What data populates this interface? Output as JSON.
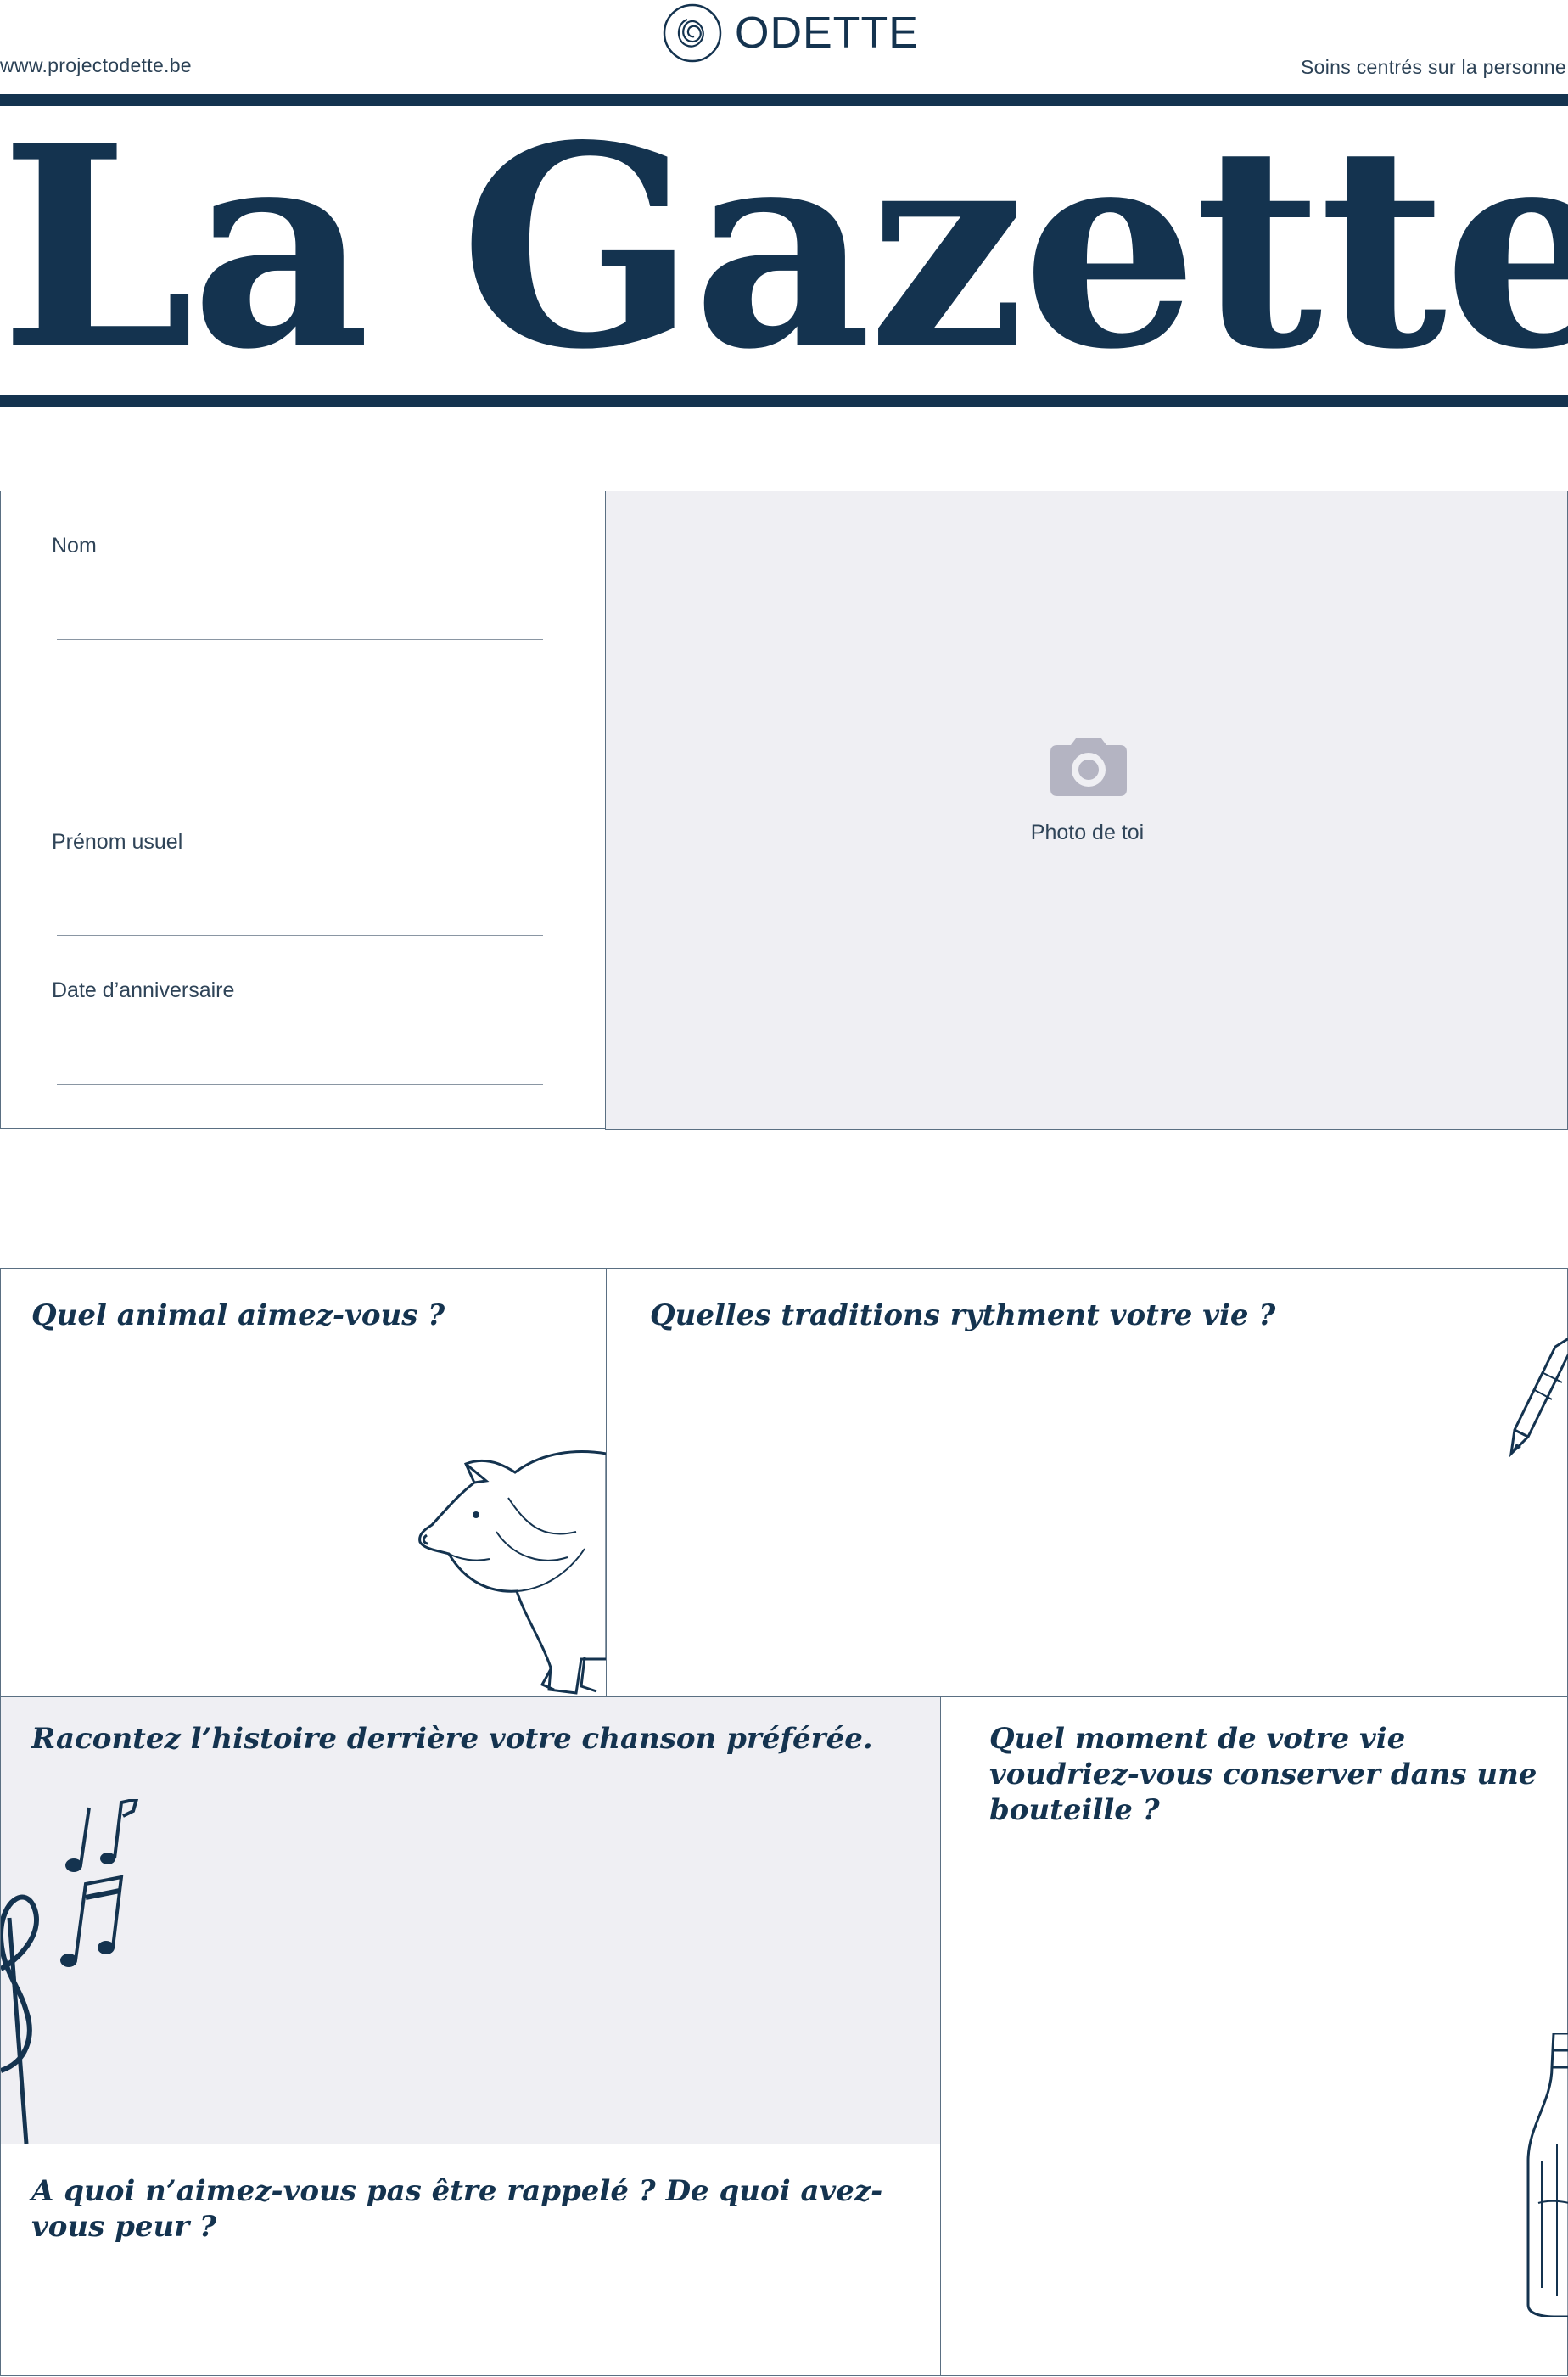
{
  "header": {
    "website": "www.projectodette.be",
    "brand": "ODETTE",
    "tagline": "Soins centrés sur la personne",
    "title": "La Gazette"
  },
  "identity": {
    "name_label": "Nom",
    "first_name_label": "Prénom usuel",
    "birthday_label": "Date d’anniversaire",
    "photo_label": "Photo de toi"
  },
  "questions": {
    "animal": "Quel animal aimez-vous ?",
    "traditions": "Quelles traditions rythment votre vie ?",
    "song": "Racontez l’histoire derrière votre chanson préférée.",
    "bottle": "Quel moment de votre vie voudriez-vous conserver dans une bouteille ?",
    "fear": "A quoi n’aimez-vous pas être rappelé ? De quoi avez-vous peur ?"
  },
  "icons": [
    "odette-logo-icon",
    "camera-icon",
    "pig-illustration",
    "pencil-illustration",
    "music-notes-illustration",
    "bottle-illustration"
  ],
  "colors": {
    "navy": "#14334f",
    "panel": "#efeff3",
    "border": "#5a6f82"
  }
}
